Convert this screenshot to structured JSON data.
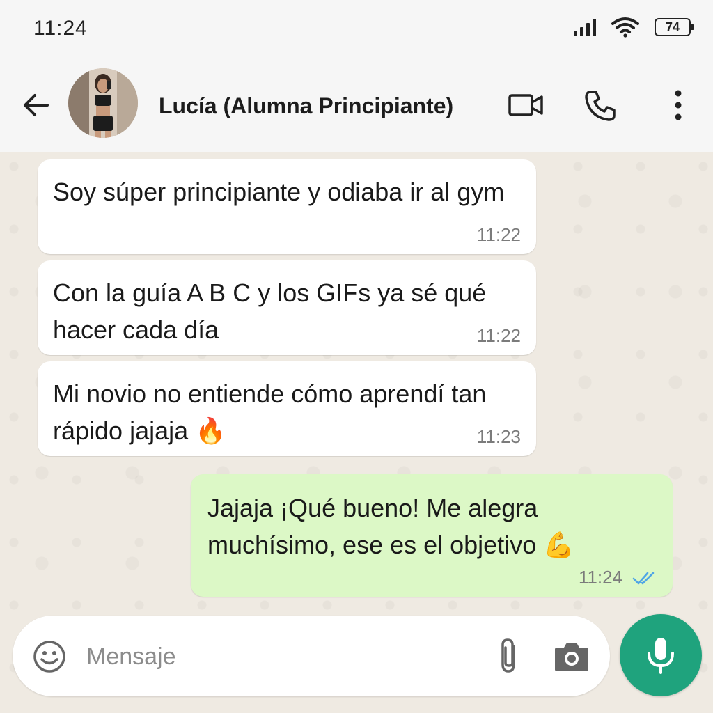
{
  "status_bar": {
    "time": "11:24",
    "battery": "74"
  },
  "header": {
    "contact_name": "Lucía (Alumna Principiante)",
    "icons": [
      "back-arrow-icon",
      "video-call-icon",
      "phone-icon",
      "more-vert-icon"
    ]
  },
  "messages": [
    {
      "direction": "in",
      "text": "Soy súper principiante y odiaba ir al gym",
      "time": "11:22"
    },
    {
      "direction": "in",
      "text": "Con la guía A B C y los GIFs ya sé qué hacer cada día",
      "time": "11:22"
    },
    {
      "direction": "in",
      "text": "Mi novio no entiende cómo aprendí tan rápido jajaja 🔥",
      "time": "11:23"
    },
    {
      "direction": "out",
      "text": "Jajaja ¡Qué bueno! Me alegra muchísimo, ese es el objetivo 💪",
      "time": "11:24",
      "status": "read"
    }
  ],
  "composer": {
    "placeholder": "Mensaje"
  },
  "colors": {
    "outgoing_bubble": "#dcf8c6",
    "incoming_bubble": "#ffffff",
    "mic_button": "#1fa37d",
    "read_ticks": "#4fa5e6",
    "chat_background": "#efeae2"
  }
}
